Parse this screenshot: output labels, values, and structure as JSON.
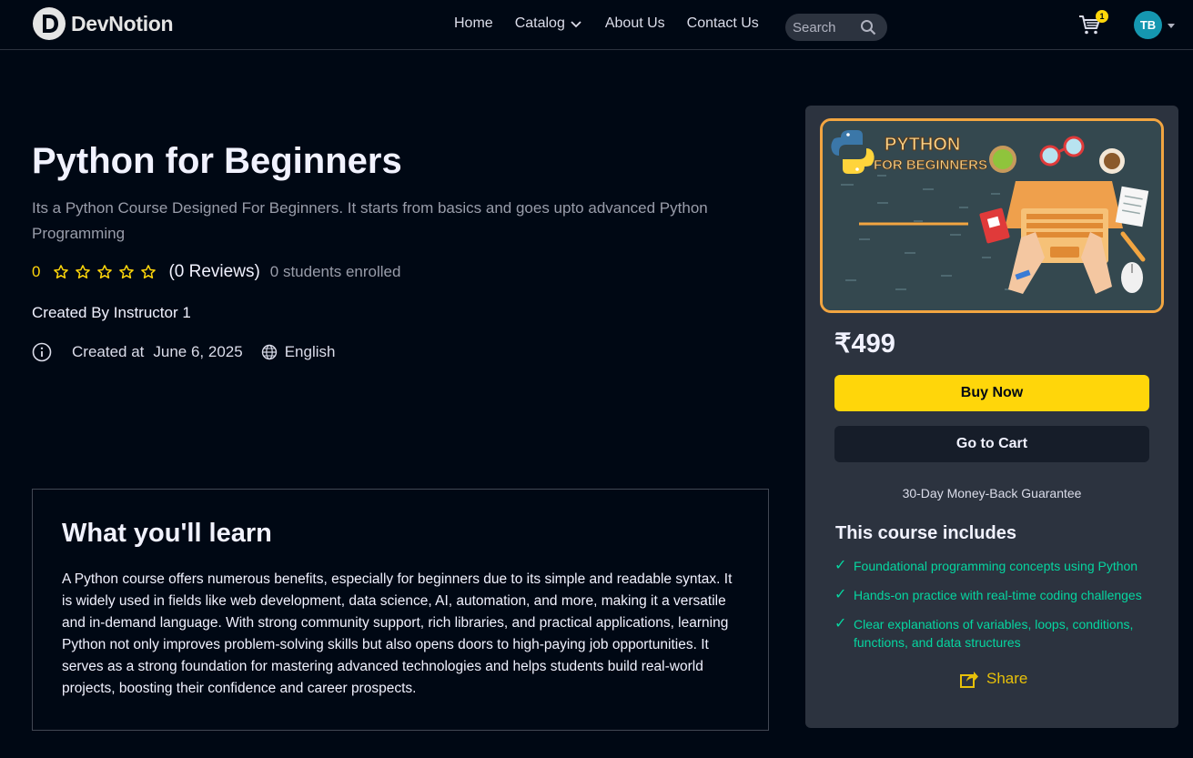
{
  "nav": {
    "brand": "DevNotion",
    "logo_letter": "D",
    "links": [
      "Home",
      "Catalog",
      "About Us",
      "Contact Us"
    ],
    "search_placeholder": "Search",
    "cart_count": "1",
    "avatar_initials": "TB"
  },
  "course": {
    "title": "Python for Beginners",
    "description": "Its a Python Course Designed For Beginners. It starts from basics and goes upto advanced Python Programming",
    "rating": "0",
    "stars_filled": 0,
    "stars_total": 5,
    "reviews": "(0 Reviews)",
    "enrolled": "0 students enrolled",
    "created_by": "Created By Instructor 1",
    "created_label": "Created at",
    "created_date": "June 6, 2025",
    "language": "English"
  },
  "learn": {
    "title": "What you'll learn",
    "text": "A Python course offers numerous benefits, especially for beginners due to its simple and readable syntax. It is widely used in fields like web development, data science, AI, automation, and more, making it a versatile and in-demand language. With strong community support, rich libraries, and practical applications, learning Python not only improves problem-solving skills but also opens doors to high-paying job opportunities. It serves as a strong foundation for mastering advanced technologies and helps students build real-world projects, boosting their confidence and career prospects."
  },
  "card": {
    "thumbnail_title_1": "PYTHON",
    "thumbnail_title_2": "FOR BEGINNERS",
    "price": "₹499",
    "buy_label": "Buy Now",
    "cart_label": "Go to Cart",
    "guarantee": "30-Day Money-Back Guarantee",
    "includes_title": "This course includes",
    "includes": [
      "Foundational programming concepts using Python",
      "Hands-on practice with real-time coding challenges",
      "Clear explanations of variables, loops, conditions, functions, and data structures"
    ],
    "share_label": "Share"
  },
  "colors": {
    "background": "#000814",
    "accent_yellow": "#FFD60A",
    "card_bg": "#2C333F",
    "check_green": "#06D6A0",
    "avatar_teal": "#1597B0"
  },
  "icons": [
    "logo-icon",
    "chevron-down-icon",
    "search-icon",
    "cart-icon",
    "star-outline-icon",
    "info-icon",
    "globe-icon",
    "check-icon",
    "share-icon"
  ]
}
